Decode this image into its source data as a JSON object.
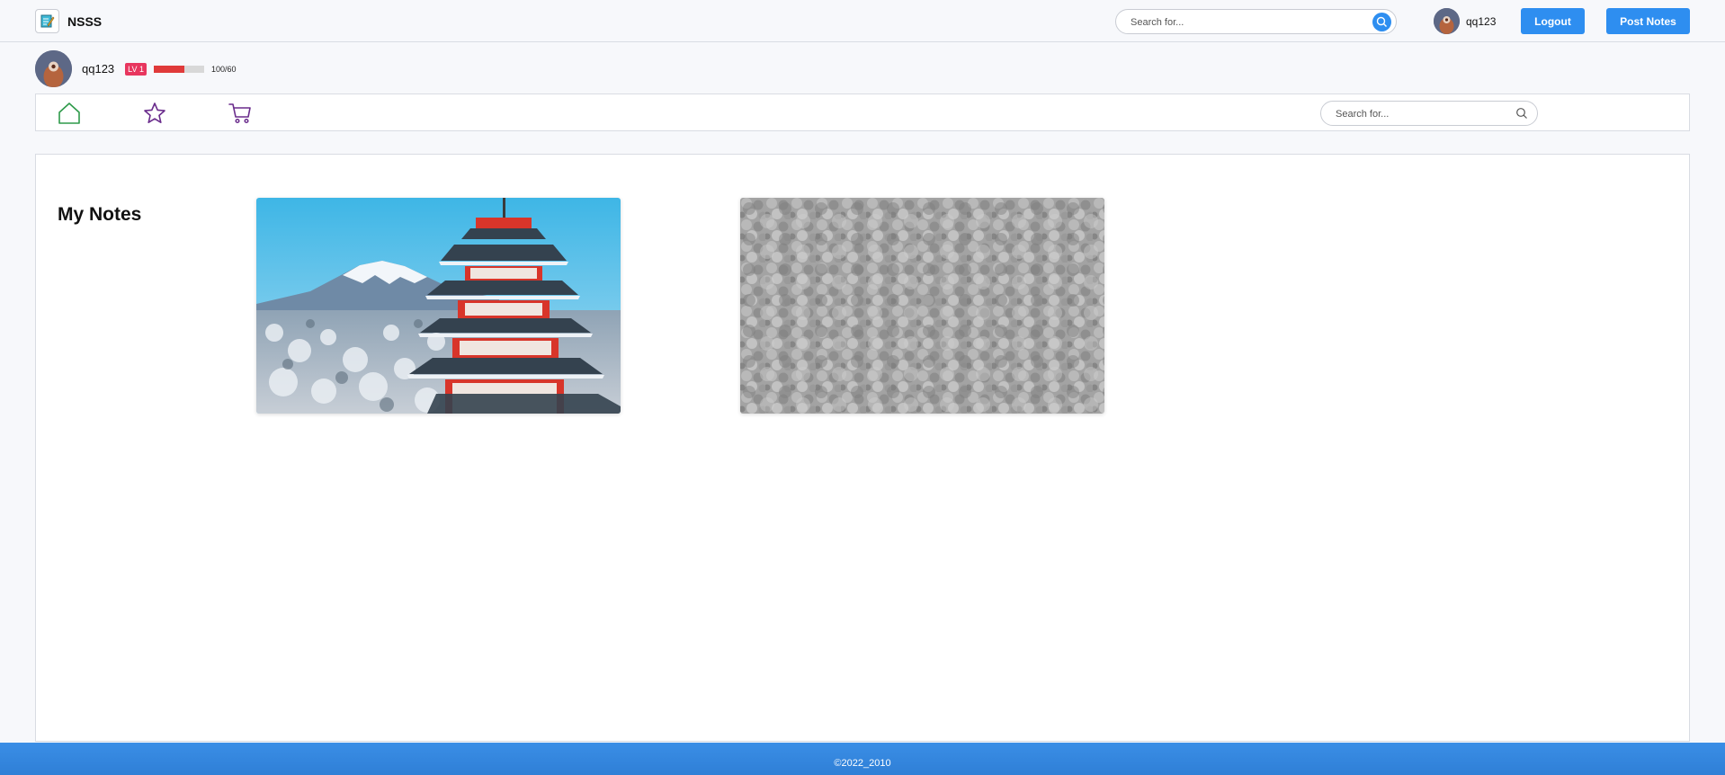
{
  "brand": {
    "name": "NSSS",
    "logo_icon": "notepad-icon"
  },
  "header": {
    "search_placeholder": "Search for...",
    "search_icon": "search-icon",
    "username": "qq123",
    "logout_label": "Logout",
    "post_label": "Post Notes"
  },
  "profile": {
    "username": "qq123",
    "level": "LV 1",
    "xp_text": "100/60",
    "xp_fraction": 0.6
  },
  "nav": {
    "items": [
      {
        "icon": "home-icon",
        "color": "#2e9a4a"
      },
      {
        "icon": "star-icon",
        "color": "#6a2c8c"
      },
      {
        "icon": "cart-icon",
        "color": "#6a2c8c"
      }
    ],
    "search_placeholder": "Search for..."
  },
  "main": {
    "title": "My Notes",
    "notes": [
      {
        "image": "pagoda-mount-fuji-photo"
      },
      {
        "image": "gray-texture-image"
      }
    ]
  },
  "footer": {
    "text": "©2022_2010"
  },
  "colors": {
    "accent": "#2e8ef0",
    "badge": "#e8365e",
    "xp": "#e03a3a",
    "footer": "#3a8ee6"
  }
}
